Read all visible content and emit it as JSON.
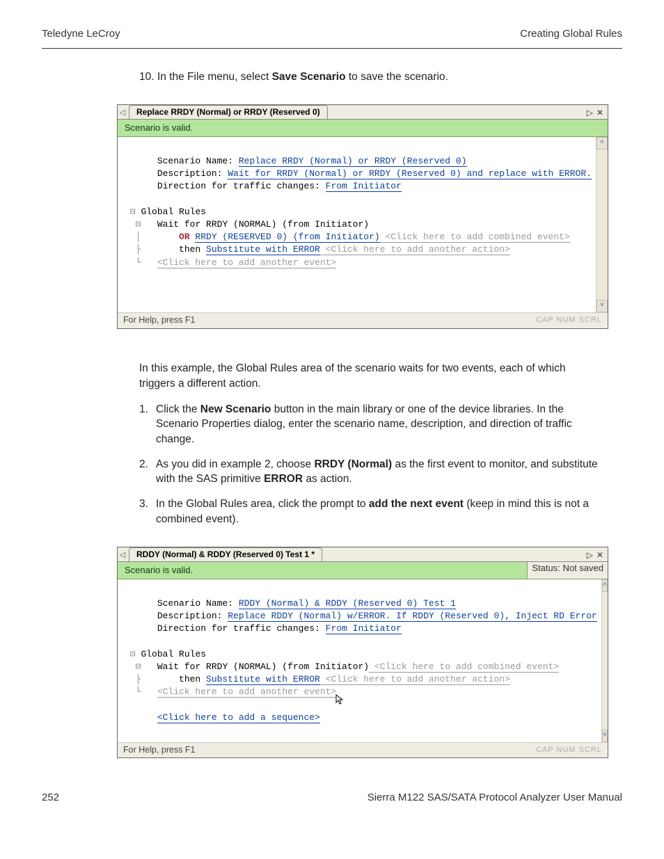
{
  "header": {
    "left": "Teledyne LeCroy",
    "right": "Creating Global Rules"
  },
  "step10": {
    "num": "10.",
    "prefix": "In the File menu, select ",
    "bold": "Save Scenario",
    "suffix": " to save the scenario."
  },
  "shot1": {
    "tab_title": "Replace RRDY (Normal) or RRDY (Reserved 0)",
    "status": "Scenario is valid.",
    "status_right": "",
    "lbl_name": "Scenario Name: ",
    "name": "Replace RRDY (Normal) or RRDY (Reserved 0)",
    "lbl_desc": "Description: ",
    "desc": "Wait for RRDY (Normal) or RRDY (Reserved 0) and replace with ERROR.",
    "lbl_dir": "Direction for traffic changes: ",
    "dir": "From Initiator",
    "global": "Global Rules",
    "wait": "Wait for RRDY (NORMAL) (from Initiator)",
    "or_kw": "OR ",
    "or_txt": "RRDY (RESERVED 0) (from Initiator)",
    "or_hint": " <Click here to add combined event>",
    "then_kw": "then ",
    "then_act": "Substitute with ERROR",
    "then_hint": " <Click here to add another action>",
    "add_evt": "<Click here to add another event>",
    "help": "For Help, press F1",
    "cap": "CAP NUM SCRL"
  },
  "mid_para": "In this example, the Global Rules area of the scenario waits for two events, each of which triggers a different action.",
  "steps": {
    "s1": {
      "n": "1.",
      "a": "Click the ",
      "b": "New Scenario",
      "c": " button in the main library or one of the device libraries. In the Scenario Properties dialog, enter the scenario name, description, and direction of traffic change."
    },
    "s2": {
      "n": "2.",
      "a": "As you did in example 2, choose ",
      "b": "RRDY (Normal)",
      "c": " as the first event to monitor, and substitute with the SAS primitive ",
      "d": "ERROR",
      "e": " as action."
    },
    "s3": {
      "n": "3.",
      "a": "In the Global Rules area, click the prompt to ",
      "b": "add the next event",
      "c": " (keep in mind this is not a combined event)."
    }
  },
  "shot2": {
    "tab_title": "RDDY (Normal) & RDDY (Reserved 0) Test 1 *",
    "status": "Scenario is valid.",
    "status_right": "Status: Not saved",
    "lbl_name": "Scenario Name: ",
    "name": "RDDY (Normal) & RDDY (Reserved 0) Test 1",
    "lbl_desc": "Description: ",
    "desc": "Replace RDDY (Normal) w/ERROR. If RDDY (Reserved 0), Inject RD Error",
    "lbl_dir": "Direction for traffic changes: ",
    "dir": "From Initiator",
    "global": "Global Rules",
    "wait": "Wait for RRDY (NORMAL) (from Initiator)",
    "wait_hint": " <Click here to add combined event>",
    "then_kw": "then ",
    "then_act": "Substitute with ERROR",
    "then_hint": " <Click here to add another action>",
    "add_evt": "<Click here to add another event>",
    "add_seq": "<Click here to add a sequence>",
    "help": "For Help, press F1",
    "cap": "CAP NUM SCRL"
  },
  "footer": {
    "left": "252",
    "right": "Sierra M122 SAS/SATA Protocol Analyzer User Manual"
  }
}
